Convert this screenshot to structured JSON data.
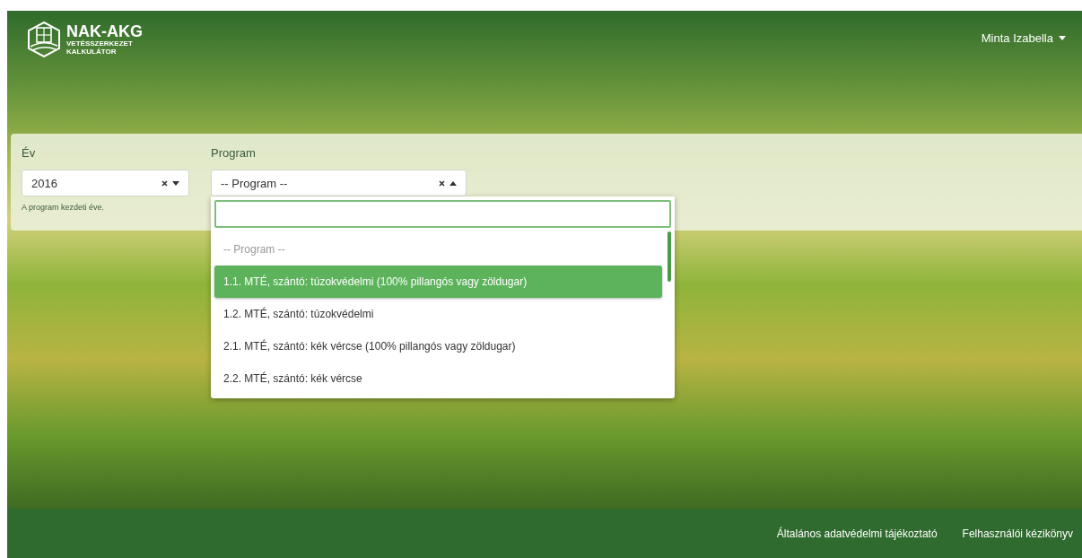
{
  "logo": {
    "title": "NAK-AKG",
    "subtitle_1": "VETÉSSZERKEZET",
    "subtitle_2": "KALKULÁTOR"
  },
  "user_menu": {
    "name": "Minta Izabella"
  },
  "year_field": {
    "label": "Év",
    "value": "2016",
    "help": "A program kezdeti éve."
  },
  "program_field": {
    "label": "Program",
    "value": "-- Program --",
    "expanded": true,
    "options": [
      {
        "label": "-- Program --",
        "kind": "placeholder",
        "highlighted": false
      },
      {
        "label": "1.1. MTÉ, szántó: túzokvédelmi (100% pillangós vagy zöldugar)",
        "kind": "option",
        "highlighted": true
      },
      {
        "label": "1.2. MTÉ, szántó: túzokvédelmi",
        "kind": "option",
        "highlighted": false
      },
      {
        "label": "2.1. MTÉ, szántó: kék vércse (100% pillangós vagy zöldugar)",
        "kind": "option",
        "highlighted": false
      },
      {
        "label": "2.2. MTÉ, szántó: kék vércse",
        "kind": "option",
        "highlighted": false
      }
    ]
  },
  "footer_links": [
    "Általános adatvédelmi tájékoztató",
    "Felhasználói kézikönyv"
  ]
}
